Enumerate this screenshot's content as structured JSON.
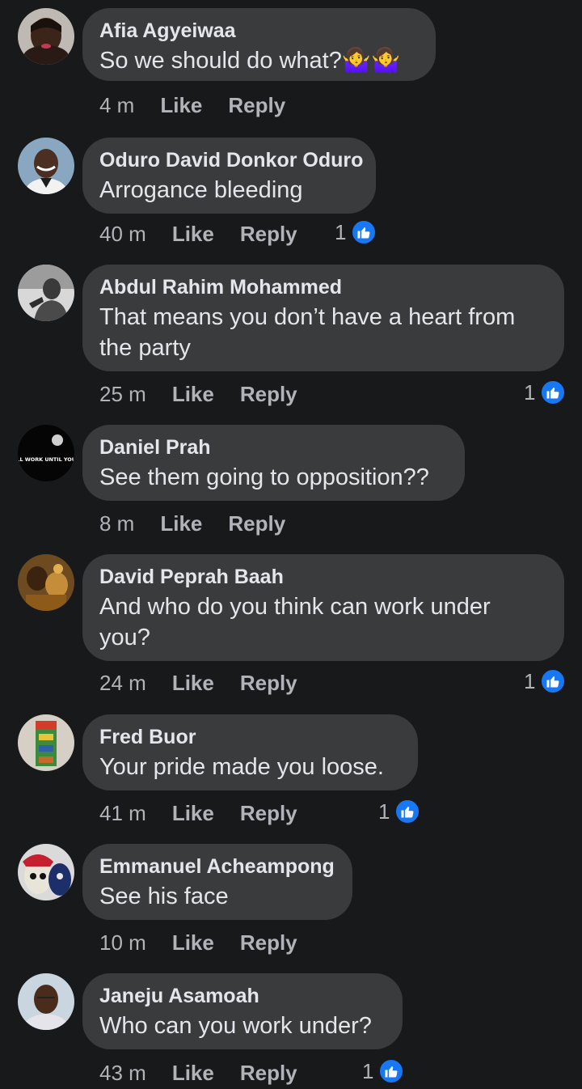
{
  "comments": [
    {
      "author": "Afia Agyeiwaa",
      "text": "So we should do what?🤷‍♀️🤷‍♀️",
      "time": "4 m",
      "like": "Like",
      "reply": "Reply",
      "reactions": ""
    },
    {
      "author": "Oduro David Donkor Oduro",
      "text": "Arrogance bleeding",
      "time": "40 m",
      "like": "Like",
      "reply": "Reply",
      "reactions": "1"
    },
    {
      "author": "Abdul Rahim Mohammed",
      "text": "That means you don’t have a heart from the party",
      "time": "25 m",
      "like": "Like",
      "reply": "Reply",
      "reactions": "1"
    },
    {
      "author": "Daniel Prah",
      "text": "See them going to opposition??",
      "time": "8 m",
      "like": "Like",
      "reply": "Reply",
      "reactions": ""
    },
    {
      "author": "David Peprah Baah",
      "text": "And who do you think can work under you?",
      "time": "24 m",
      "like": "Like",
      "reply": "Reply",
      "reactions": "1"
    },
    {
      "author": "Fred Buor",
      "text": "Your pride made you loose.",
      "time": "41 m",
      "like": "Like",
      "reply": "Reply",
      "reactions": "1"
    },
    {
      "author": "Emmanuel Acheampong",
      "text": "See his face",
      "time": "10 m",
      "like": "Like",
      "reply": "Reply",
      "reactions": ""
    },
    {
      "author": "Janeju Asamoah",
      "text": "Who can you work under?",
      "time": "43 m",
      "like": "Like",
      "reply": "Reply",
      "reactions": "1"
    }
  ],
  "avatar_text": {
    "daniel_prah": "YOU'LL WORK UNTIL YOU DIE."
  },
  "colors": {
    "background": "#18191a",
    "bubble": "#3a3b3c",
    "primary_text": "#e4e6eb",
    "secondary_text": "#b0b3b8",
    "like_blue": "#1877f2"
  },
  "icons": {
    "reaction": "like-thumbs-up-icon"
  }
}
